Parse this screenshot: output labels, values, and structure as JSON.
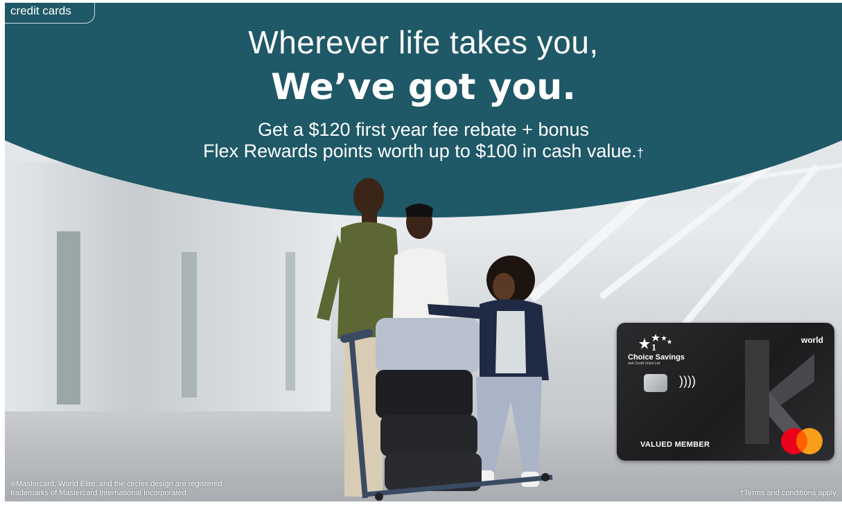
{
  "tab": {
    "label": "credit cards"
  },
  "headline": {
    "line1": "Wherever life takes you,",
    "line2": "We’ve got you.",
    "offer_line1": "Get a $120 first year fee rebate + bonus",
    "offer_line2": "Flex Rewards points worth up to $100 in cash value.",
    "dagger": "†"
  },
  "card": {
    "tier": "world",
    "brand": "Choice Savings",
    "brand_sub": "and Credit Union Ltd.",
    "holder": "VALUED MEMBER",
    "contactless_symbol": "))))",
    "network": "mastercard-logo"
  },
  "footer": {
    "trademark_line1": "®Mastercard, World Elite, and the circles design are registered",
    "trademark_line2": "trademarks of Mastercard International Incorporated.",
    "terms": "†Terms and conditions apply."
  },
  "colors": {
    "teal": "#1f5866",
    "mc_red": "#eb001b",
    "mc_orange": "#f79e1b"
  }
}
